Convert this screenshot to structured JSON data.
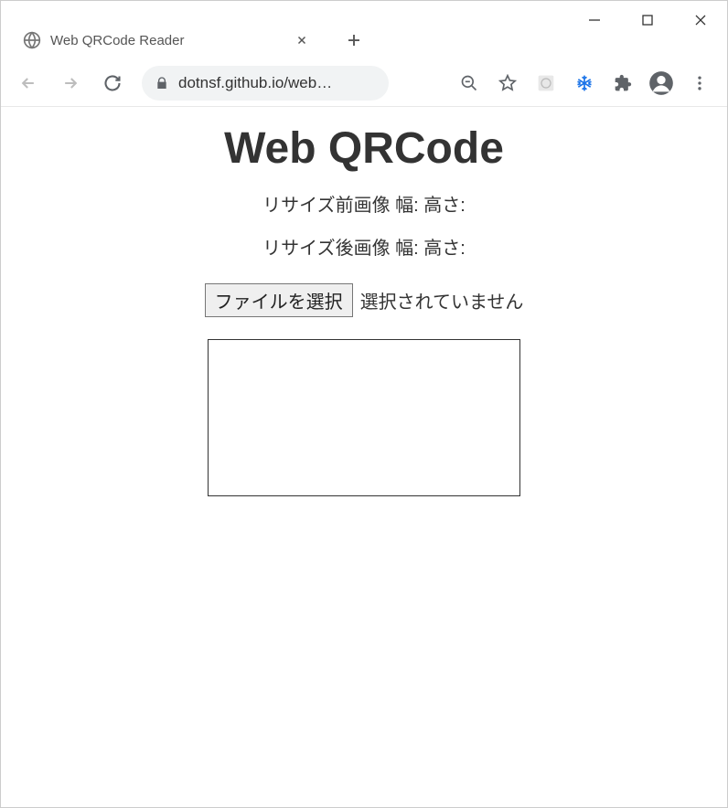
{
  "browser": {
    "tab_title": "Web QRCode Reader",
    "url_display": "dotnsf.github.io/web…"
  },
  "page": {
    "title": "Web QRCode",
    "resize_before": "リサイズ前画像 幅: 高さ:",
    "resize_after": "リサイズ後画像 幅: 高さ:",
    "file_button_label": "ファイルを選択",
    "file_status": "選択されていません"
  }
}
